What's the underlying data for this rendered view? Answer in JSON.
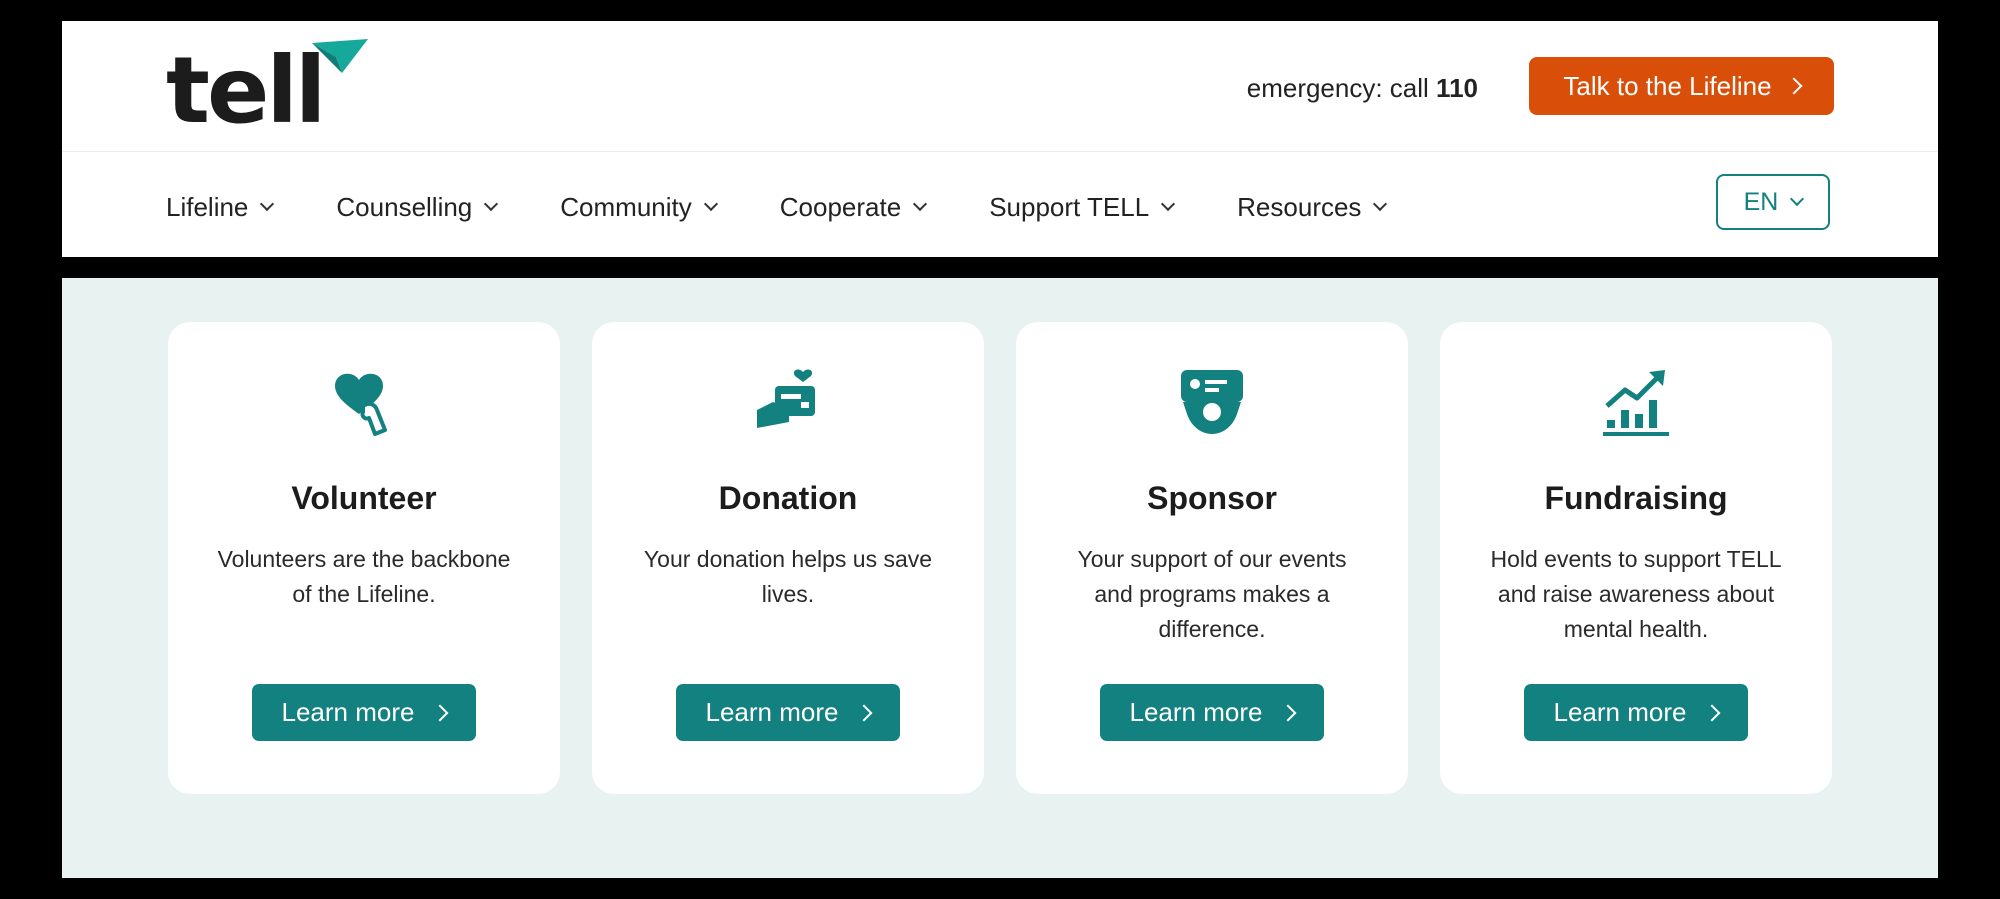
{
  "brand": {
    "logo_text": "tell",
    "accent": "#12817f",
    "cta_color": "#d94e09",
    "bg_mint": "#e8f2f0"
  },
  "header": {
    "emergency_prefix": "emergency: call",
    "emergency_number": "110",
    "lifeline_button": "Talk to the Lifeline"
  },
  "nav": {
    "items": [
      {
        "label": "Lifeline"
      },
      {
        "label": "Counselling"
      },
      {
        "label": "Community"
      },
      {
        "label": "Cooperate"
      },
      {
        "label": "Support TELL"
      },
      {
        "label": "Resources"
      }
    ],
    "language": "EN"
  },
  "cards": [
    {
      "icon": "heart-hand-icon",
      "title": "Volunteer",
      "description": "Volunteers are the backbone of the Lifeline.",
      "button": "Learn more"
    },
    {
      "icon": "card-heart-icon",
      "title": "Donation",
      "description": "Your donation helps us save lives.",
      "button": "Learn more"
    },
    {
      "icon": "sponsor-badge-icon",
      "title": "Sponsor",
      "description": "Your support of our events and programs makes a difference.",
      "button": "Learn more"
    },
    {
      "icon": "growth-chart-icon",
      "title": "Fundraising",
      "description": "Hold events to support TELL and raise awareness about mental health.",
      "button": "Learn more"
    }
  ]
}
